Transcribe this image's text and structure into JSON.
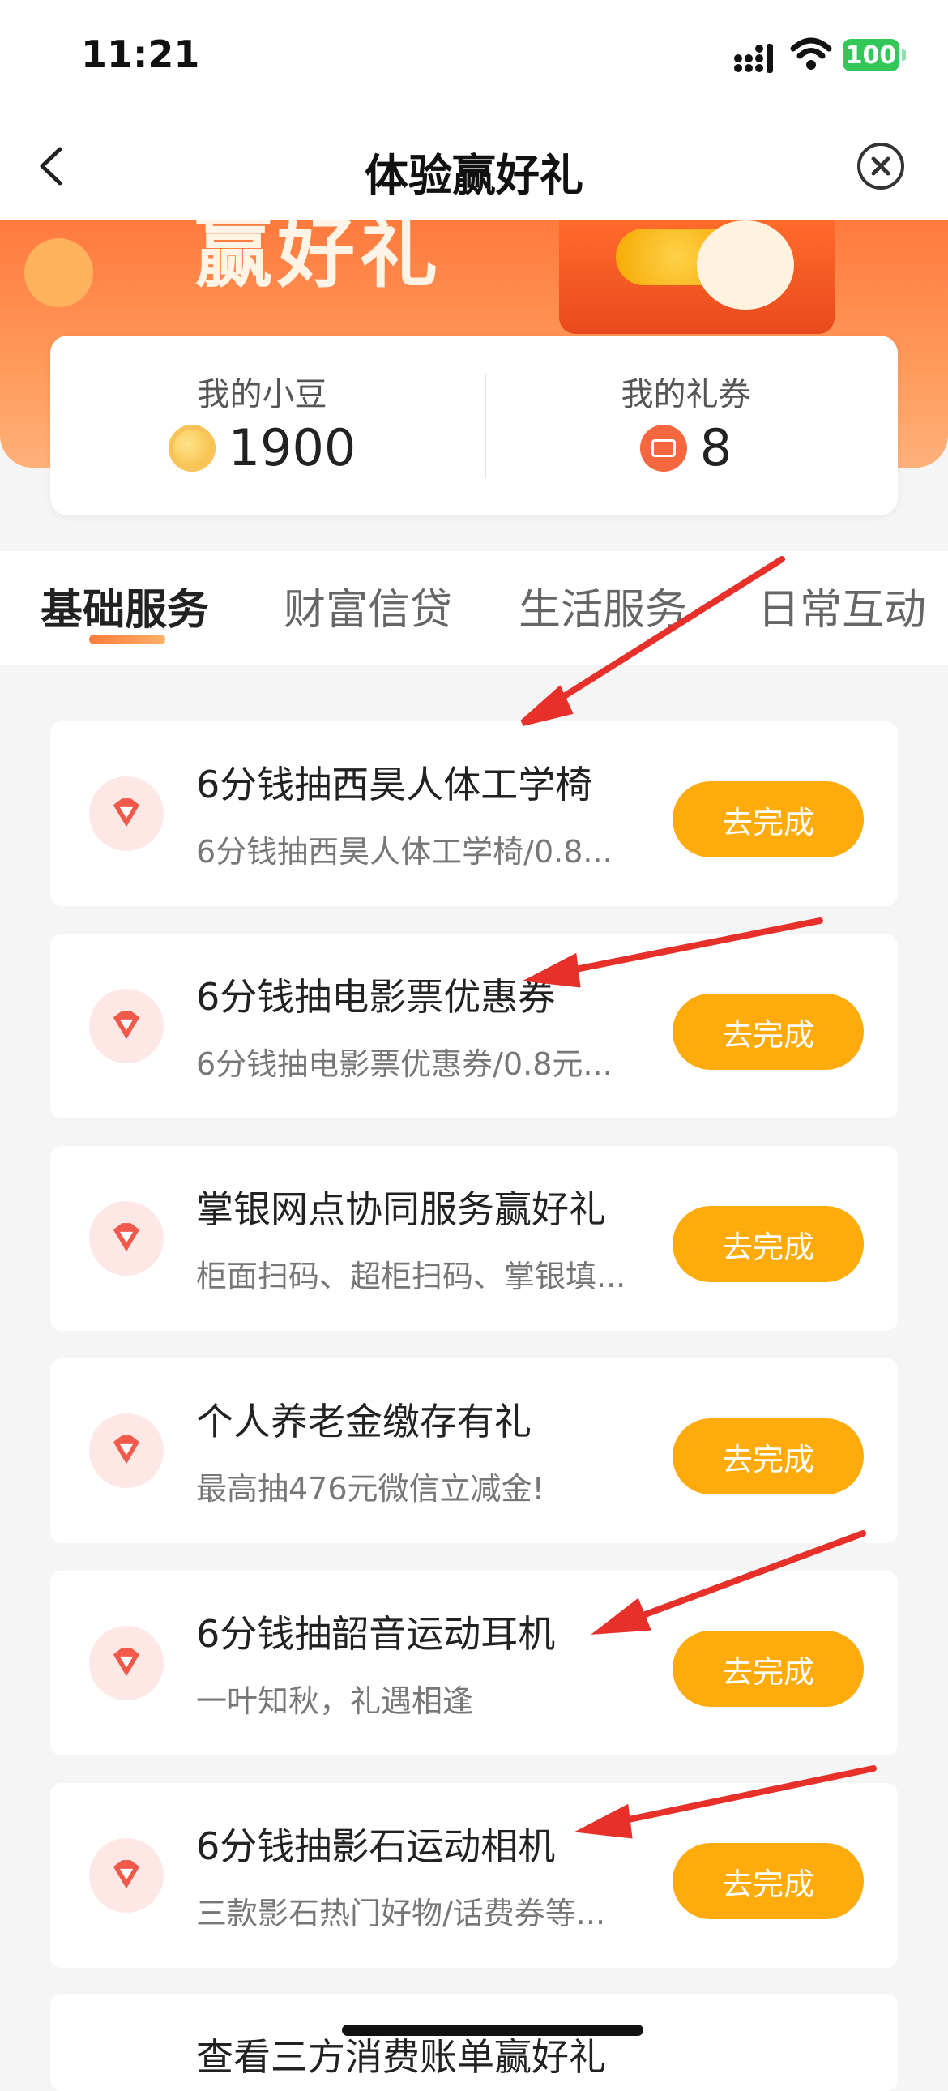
{
  "status_bar": {
    "time": "11:21",
    "battery": "100"
  },
  "nav": {
    "title": "体验赢好礼"
  },
  "banner": {
    "text": "赢好礼"
  },
  "summary": {
    "beans_label": "我的小豆",
    "beans_value": "1900",
    "coupons_label": "我的礼券",
    "coupons_value": "8"
  },
  "tabs": [
    {
      "label": "基础服务"
    },
    {
      "label": "财富信贷"
    },
    {
      "label": "生活服务"
    },
    {
      "label": "日常互动"
    }
  ],
  "tasks": [
    {
      "title": "6分钱抽西昊人体工学椅",
      "subtitle": "6分钱抽西昊人体工学椅/0.8...",
      "button": "去完成"
    },
    {
      "title": "6分钱抽电影票优惠券",
      "subtitle": "6分钱抽电影票优惠券/0.8元...",
      "button": "去完成"
    },
    {
      "title": "掌银网点协同服务赢好礼",
      "subtitle": "柜面扫码、超柜扫码、掌银填...",
      "button": "去完成"
    },
    {
      "title": "个人养老金缴存有礼",
      "subtitle": "最高抽476元微信立减金!",
      "button": "去完成"
    },
    {
      "title": "6分钱抽韶音运动耳机",
      "subtitle": "一叶知秋，礼遇相逢",
      "button": "去完成"
    },
    {
      "title": "6分钱抽影石运动相机",
      "subtitle": "三款影石热门好物/话费券等...",
      "button": "去完成"
    }
  ],
  "partial_task": {
    "title": "查看三方消费账单赢好礼"
  },
  "colors": {
    "accent": "#ff7a3d",
    "button": "#ffab0b",
    "arrow": "#e8302a"
  },
  "icons": [
    "back-icon",
    "close-icon",
    "coin-icon",
    "ticket-icon",
    "diamond-icon"
  ]
}
